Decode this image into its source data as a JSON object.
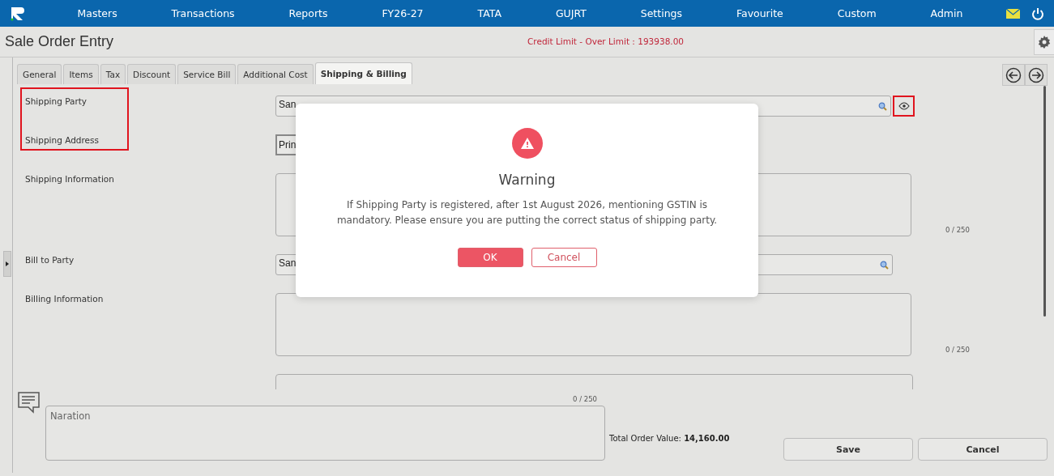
{
  "nav": {
    "items": [
      "Masters",
      "Transactions",
      "Reports",
      "FY26-27",
      "TATA",
      "GUJRT",
      "Settings",
      "Favourite",
      "Custom",
      "Admin"
    ]
  },
  "page": {
    "title": "Sale Order Entry",
    "credit_notice": "Credit Limit - Over Limit : 193938.00"
  },
  "tabs": [
    {
      "label": "General",
      "selected": false
    },
    {
      "label": "Items",
      "selected": false
    },
    {
      "label": "Tax",
      "selected": false
    },
    {
      "label": "Discount",
      "selected": false
    },
    {
      "label": "Service Bill",
      "selected": false
    },
    {
      "label": "Additional Cost",
      "selected": false
    },
    {
      "label": "Shipping & Billing",
      "selected": true
    }
  ],
  "form": {
    "labels_highlighted": true,
    "eye_highlighted": true,
    "fields": [
      {
        "kind": "lookup",
        "label": "Shipping Party",
        "value": "San"
      },
      {
        "kind": "select",
        "label": "Shipping Address",
        "value": "Prin"
      },
      {
        "kind": "textarea",
        "label": "Shipping Information",
        "counter": "0 / 250"
      },
      {
        "kind": "lookup",
        "label": "Bill to Party",
        "value": "San"
      },
      {
        "kind": "textarea",
        "label": "Billing Information",
        "counter": "0 / 250"
      }
    ]
  },
  "narration": {
    "placeholder": "Naration",
    "counter": "0 / 250"
  },
  "total": {
    "label": "Total Order Value:",
    "value": "14,160.00"
  },
  "buttons": [
    "Save",
    "Cancel"
  ],
  "dialog": {
    "title": "Warning",
    "message": "If Shipping Party is registered, after 1st August 2026, mentioning GSTIN is mandatory. Please ensure you are putting the correct status of shipping party.",
    "buttons": [
      {
        "label": "OK",
        "kind": "primary"
      },
      {
        "label": "Cancel",
        "kind": "secondary"
      }
    ]
  }
}
